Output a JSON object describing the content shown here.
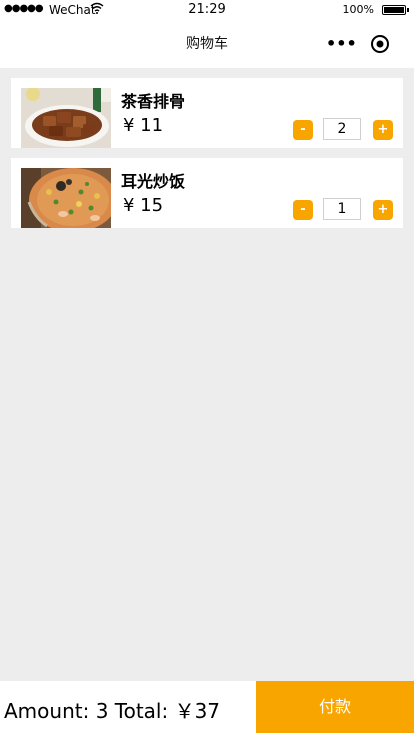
{
  "status_bar": {
    "signal": "●●●●●",
    "carrier": "WeChat",
    "wifi_icon": "wifi-icon",
    "time": "21:29",
    "battery": "100%"
  },
  "nav": {
    "title": "购物车",
    "more_label": "•••"
  },
  "cart": {
    "items": [
      {
        "name": "茶香排骨",
        "price": "¥ 11",
        "quantity": "2",
        "minus": "-",
        "plus": "+",
        "image": "braised-ribs-photo"
      },
      {
        "name": "耳光炒饭",
        "price": "¥ 15",
        "quantity": "1",
        "minus": "-",
        "plus": "+",
        "image": "fried-rice-photo"
      }
    ]
  },
  "footer": {
    "summary": "Amount: 3 Total: ￥37",
    "pay_label": "付款"
  },
  "colors": {
    "accent": "#f9a500",
    "background": "#ededed"
  }
}
